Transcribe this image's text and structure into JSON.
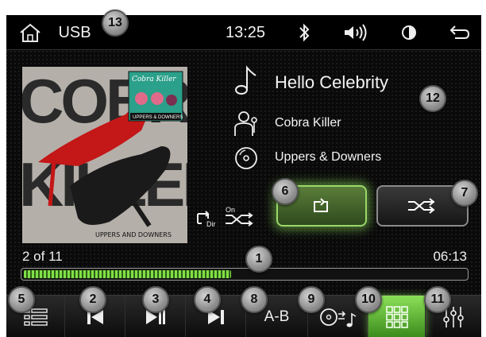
{
  "status_bar": {
    "source_label": "USB",
    "clock": "13:25"
  },
  "album_art": {
    "band_text_lines": [
      "COBRA",
      "KILLER"
    ],
    "sticker_title": "Cobra Killer",
    "sticker_subtitle": "UPPERS & DOWNERS",
    "bottom_text": "UPPERS AND DOWNERS"
  },
  "track": {
    "title": "Hello Celebrity",
    "artist": "Cobra Killer",
    "album": "Uppers & Downers"
  },
  "mode_icons": {
    "repeat_dir_label": "Dir",
    "shuffle_on_label": "On"
  },
  "playback": {
    "track_position": "2 of 11",
    "duration": "06:13",
    "progress_fraction": 0.47
  },
  "toolbar": {
    "ab_label": "A-B"
  },
  "callouts": [
    "1",
    "2",
    "3",
    "4",
    "5",
    "6",
    "7",
    "8",
    "9",
    "10",
    "11",
    "12",
    "13"
  ],
  "colors": {
    "accent_green": "#7fe045",
    "background": "#0a0a0a"
  }
}
